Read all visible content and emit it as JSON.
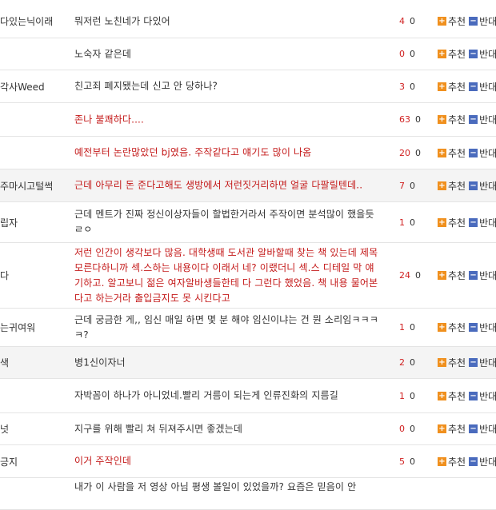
{
  "vote": {
    "up_label": "추천",
    "down_label": "반대"
  },
  "comments": [
    {
      "nick": "다있는닉이래",
      "text": "뭐저런 노친네가 다있어",
      "up": "4",
      "down": "0",
      "red": false,
      "alt": false,
      "h": 42
    },
    {
      "nick": "",
      "text": "노숙자 같은데",
      "up": "0",
      "down": "0",
      "red": false,
      "alt": false,
      "h": 40
    },
    {
      "nick": "각사Weed",
      "text": "친고죄 폐지됐는데 신고 안 당하나?",
      "up": "3",
      "down": "0",
      "red": false,
      "alt": false,
      "h": 41
    },
    {
      "nick": "",
      "text": "존나 불쾌하다....",
      "up": "63",
      "down": "0",
      "red": true,
      "alt": false,
      "h": 42
    },
    {
      "nick": "",
      "text": "예전부터 논란많았던 bj였음. 주작같다고 얘기도 많이 나옴",
      "up": "20",
      "down": "0",
      "red": true,
      "alt": false,
      "h": 41
    },
    {
      "nick": "주마시고털썩",
      "text": "근데 아무리 돈 준다고해도 생방에서 저런짓거리하면 얼굴 다팔릴텐데..",
      "up": "7",
      "down": "0",
      "red": true,
      "alt": true,
      "h": 41
    },
    {
      "nick": "립자",
      "text": "근데 멘트가 진짜 정신이상자들이 할법한거라서 주작이면 분석많이 했을듯ㄹㅇ",
      "up": "1",
      "down": "0",
      "red": false,
      "alt": false,
      "h": 51
    },
    {
      "nick": "다",
      "text": "저런 인간이 생각보다 많음. 대학생때 도서관 알바할때 찾는 책 있는데 제목 모른다하니까 섹.스하는 내용이다 이래서 네? 이랬더니 섹.스 디테일 막 얘기하고. 알고보니 젊은 여자알바생들한테 다 그런다 했었음. 책 내용 물어본다고 하는거라 출입금지도 못 시킨다고",
      "up": "24",
      "down": "0",
      "red": true,
      "alt": false,
      "h": 82
    },
    {
      "nick": "는귀여워",
      "text": "근데 궁금한 게,, 임신 매일 하면 몇 분 해야 임신이냐는 건 뭔 소리임ㅋㅋㅋㅋ?",
      "up": "1",
      "down": "0",
      "red": false,
      "alt": false,
      "h": 48
    },
    {
      "nick": "색",
      "text": "병1신이자너",
      "up": "2",
      "down": "0",
      "red": false,
      "alt": true,
      "h": 40
    },
    {
      "nick": "",
      "text": "자박꼼이 하나가 아니었네.빨리 거름이 되는게 인류진화의 지름길",
      "up": "1",
      "down": "0",
      "red": false,
      "alt": false,
      "h": 43
    },
    {
      "nick": "넛",
      "text": "지구를 위해 빨리 쳐 뒤져주시면 좋겠는데",
      "up": "0",
      "down": "0",
      "red": false,
      "alt": false,
      "h": 40
    },
    {
      "nick": "긍지",
      "text": "이거 주작인데",
      "up": "5",
      "down": "0",
      "red": true,
      "alt": false,
      "h": 41
    },
    {
      "nick": "",
      "text": "내가 이 사람을 저 영상 아님 평생 볼일이 있었을까? 요즘은 믿음이 안",
      "up": "",
      "down": "",
      "red": false,
      "alt": false,
      "h": 40
    }
  ]
}
